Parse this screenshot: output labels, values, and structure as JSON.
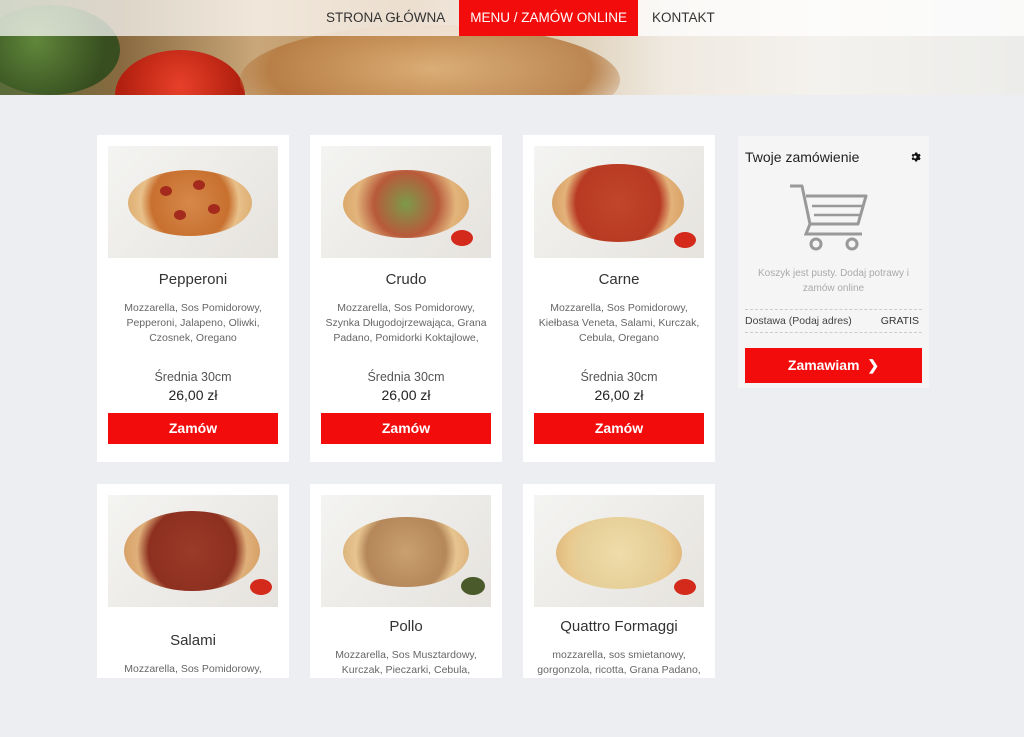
{
  "nav": {
    "items": [
      {
        "label": "STRONA GŁÓWNA",
        "active": false
      },
      {
        "label": "MENU / ZAMÓW ONLINE",
        "active": true
      },
      {
        "label": "KONTAKT",
        "active": false
      }
    ]
  },
  "products": [
    {
      "name": "Pepperoni",
      "description": "Mozzarella, Sos Pomidorowy, Pepperoni, Jalapeno, Oliwki, Czosnek, Oregano",
      "size": "Średnia 30cm",
      "price": "26,00 zł",
      "button": "Zamów"
    },
    {
      "name": "Crudo",
      "description": "Mozzarella, Sos Pomidorowy, Szynka Długodojrzewająca, Grana Padano, Pomidorki Koktajlowe,",
      "size": "Średnia 30cm",
      "price": "26,00 zł",
      "button": "Zamów"
    },
    {
      "name": "Carne",
      "description": "Mozzarella, Sos Pomidorowy, Kiełbasa Veneta, Salami, Kurczak, Cebula, Oregano",
      "size": "Średnia 30cm",
      "price": "26,00 zł",
      "button": "Zamów"
    },
    {
      "name": "Salami",
      "description": "Mozzarella, Sos Pomidorowy,"
    },
    {
      "name": "Pollo",
      "description": "Mozzarella, Sos Musztardowy, Kurczak, Pieczarki, Cebula, Papryka,"
    },
    {
      "name": "Quattro Formaggi",
      "description": "mozzarella, sos smietanowy, gorgonzola, ricotta, Grana Padano,"
    }
  ],
  "order": {
    "title": "Twoje zamówienie",
    "empty_text": "Koszyk jest pusty. Dodaj potrawy i zamów online",
    "delivery_label": "Dostawa (Podaj adres)",
    "delivery_price": "GRATIS",
    "button": "Zamawiam",
    "icons": {
      "settings": "gear-icon",
      "cart": "shopping-cart-icon",
      "arrow": "chevron-right-icon"
    }
  },
  "colors": {
    "accent": "#f20c0c",
    "background": "#eceef1"
  }
}
